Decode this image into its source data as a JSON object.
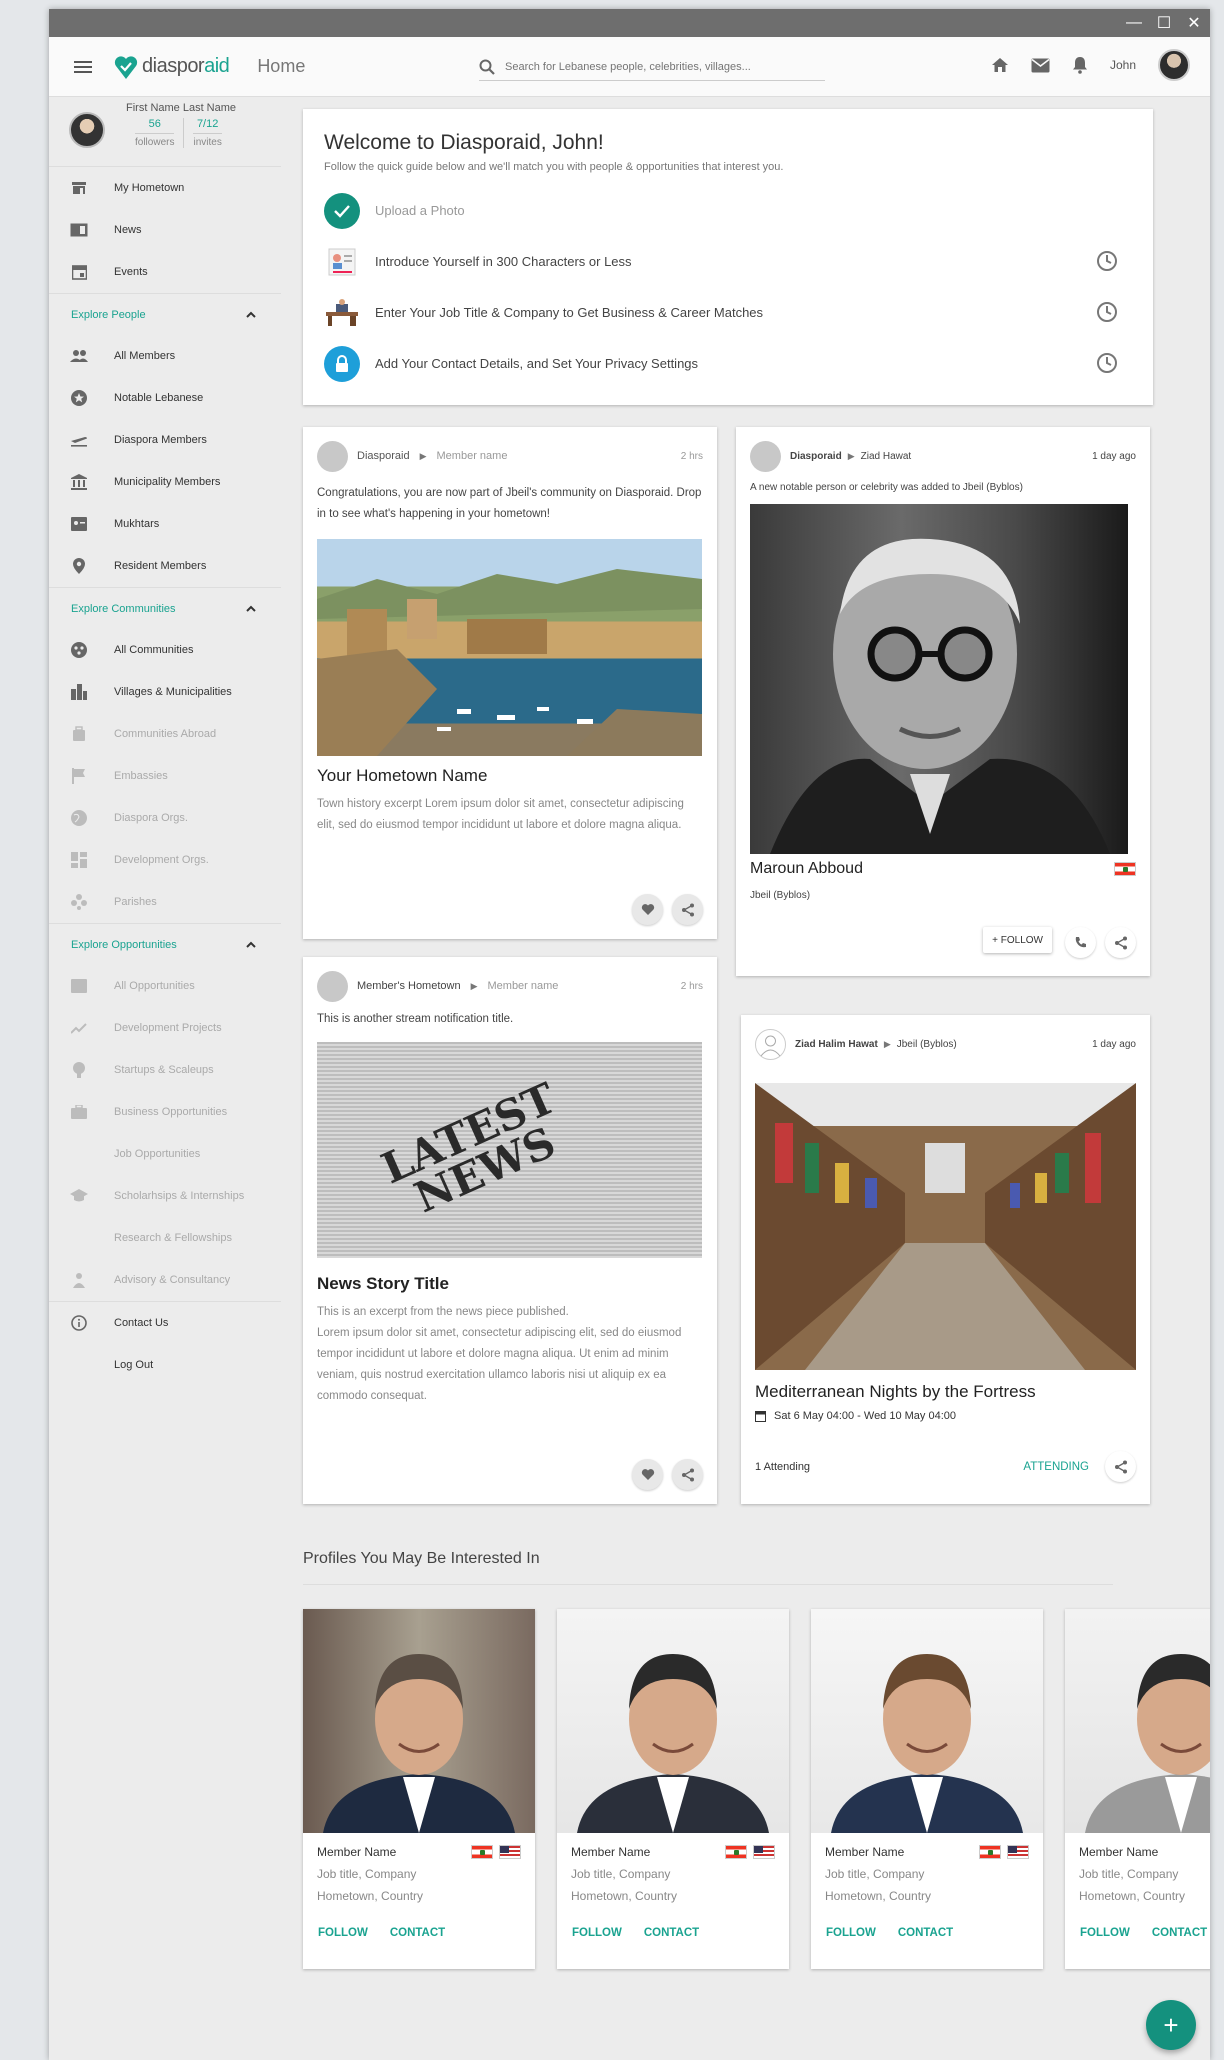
{
  "window": {
    "minimize": "—",
    "maximize": "☐",
    "close": "✕"
  },
  "appbar": {
    "logo_prefix": "diaspor",
    "logo_suffix": "aid",
    "page_title": "Home",
    "search_placeholder": "Search for Lebanese people, celebrities, villages...",
    "user_name": "John"
  },
  "profile": {
    "name": "First Name Last Name",
    "followers_value": "56",
    "followers_label": "followers",
    "invites_value": "7/12",
    "invites_label": "invites"
  },
  "nav": {
    "top": [
      {
        "label": "My Hometown",
        "icon": "store-icon"
      },
      {
        "label": "News",
        "icon": "news-icon"
      },
      {
        "label": "Events",
        "icon": "calendar-icon"
      }
    ],
    "explore_people": {
      "heading": "Explore People",
      "items": [
        {
          "label": "All Members",
          "icon": "people-icon"
        },
        {
          "label": "Notable Lebanese",
          "icon": "star-icon"
        },
        {
          "label": "Diaspora Members",
          "icon": "airplane-icon"
        },
        {
          "label": "Municipality Members",
          "icon": "bank-icon"
        },
        {
          "label": "Mukhtars",
          "icon": "id-card-icon"
        },
        {
          "label": "Resident Members",
          "icon": "pin-icon"
        }
      ]
    },
    "explore_communities": {
      "heading": "Explore Communities",
      "items": [
        {
          "label": "All Communities",
          "icon": "communities-icon",
          "dim": false
        },
        {
          "label": "Villages & Municipalities",
          "icon": "city-icon",
          "dim": false
        },
        {
          "label": "Communities Abroad",
          "icon": "luggage-icon",
          "dim": true
        },
        {
          "label": "Embassies",
          "icon": "flag-icon",
          "dim": true
        },
        {
          "label": "Diaspora Orgs.",
          "icon": "globe-icon",
          "dim": true
        },
        {
          "label": "Development Orgs.",
          "icon": "dashboard-icon",
          "dim": true
        },
        {
          "label": "Parishes",
          "icon": "parish-icon",
          "dim": true
        }
      ]
    },
    "explore_opportunities": {
      "heading": "Explore Opportunities",
      "items": [
        {
          "label": "All Opportunities",
          "icon": "list-icon"
        },
        {
          "label": "Development Projects",
          "icon": "trend-icon"
        },
        {
          "label": "Startups & Scaleups",
          "icon": "bulb-icon"
        },
        {
          "label": "Business Opportunities",
          "icon": "briefcase-icon"
        },
        {
          "label": "Job Opportunities",
          "icon": "job-icon"
        },
        {
          "label": "Scholarhsips & Internships",
          "icon": "school-icon"
        },
        {
          "label": "Research & Fellowships",
          "icon": "research-icon"
        },
        {
          "label": "Advisory & Consultancy",
          "icon": "advisory-icon"
        }
      ]
    },
    "bottom": [
      {
        "label": "Contact Us",
        "icon": "info-icon"
      },
      {
        "label": "Log Out",
        "icon": ""
      }
    ]
  },
  "welcome": {
    "title": "Welcome to Diasporaid, John!",
    "subtitle": "Follow the quick guide below and we'll match you with people & opportunities that interest you.",
    "steps": [
      "Upload a Photo",
      "Introduce Yourself in 300 Characters or Less",
      "Enter Your Job Title & Company to Get Business & Career Matches",
      "Add Your Contact Details, and Set Your Privacy Settings"
    ]
  },
  "posts": {
    "hometown": {
      "source": "Diasporaid",
      "target": "Member name",
      "time": "2 hrs",
      "text": "Congratulations, you are now part of Jbeil's community on Diasporaid. Drop in to see what's happening in your hometown!",
      "title": "Your Hometown Name",
      "excerpt": "Town history excerpt Lorem ipsum dolor sit amet, consectetur adipiscing elit, sed do eiusmod tempor incididunt ut labore et dolore magna aliqua."
    },
    "notable": {
      "source": "Diasporaid",
      "target": "Ziad Hawat",
      "time": "1 day ago",
      "text": "A new notable person or celebrity was added to Jbeil (Byblos)",
      "name": "Maroun Abboud",
      "place": "Jbeil (Byblos)",
      "follow": "+ FOLLOW"
    },
    "news": {
      "source": "Member's Hometown",
      "target": "Member name",
      "time": "2 hrs",
      "text": "This is another stream notification title.",
      "image_line1": "LATEST",
      "image_line2": "NEWS",
      "title": "News Story Title",
      "excerpt": "This is an excerpt from the news piece published.\nLorem ipsum dolor sit amet, consectetur adipiscing elit, sed do eiusmod tempor incididunt ut labore et dolore magna aliqua. Ut enim ad minim veniam, quis nostrud exercitation ullamco laboris nisi ut aliquip ex ea commodo consequat."
    },
    "event": {
      "source": "Ziad Halim Hawat",
      "target": "Jbeil (Byblos)",
      "time": "1 day ago",
      "title": "Mediterranean Nights by the Fortress",
      "date": "Sat 6 May 04:00 - Wed 10 May 04:00",
      "attending_count": "1 Attending",
      "attending_btn": "ATTENDING"
    }
  },
  "profiles_section": {
    "title": "Profiles You May Be Interested In",
    "cards": [
      {
        "name": "Member Name",
        "job": "Job title, Company",
        "home": "Hometown, Country",
        "follow": "FOLLOW",
        "contact": "CONTACT"
      },
      {
        "name": "Member Name",
        "job": "Job title, Company",
        "home": "Hometown, Country",
        "follow": "FOLLOW",
        "contact": "CONTACT"
      },
      {
        "name": "Member Name",
        "job": "Job title, Company",
        "home": "Hometown, Country",
        "follow": "FOLLOW",
        "contact": "CONTACT"
      },
      {
        "name": "Member Name",
        "job": "Job title, Company",
        "home": "Hometown, Country",
        "follow": "FOLLOW",
        "contact": "CONTACT"
      }
    ]
  },
  "fab_label": "+",
  "colors": {
    "accent": "#1aa390",
    "fab": "#14917e",
    "titlebar": "#6e6e6e"
  }
}
